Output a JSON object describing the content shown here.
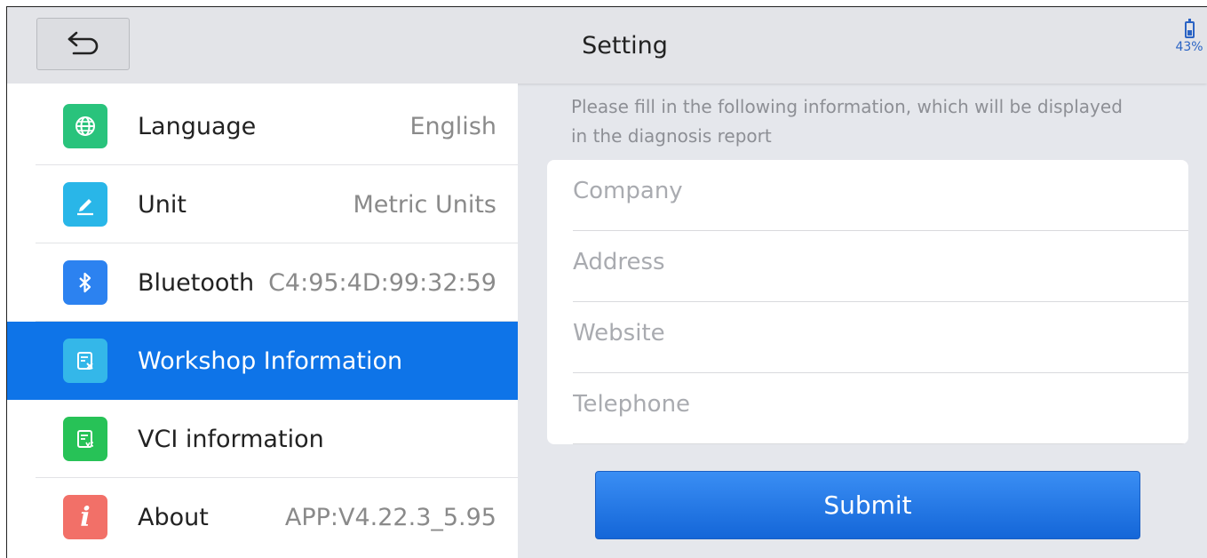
{
  "header": {
    "title": "Setting",
    "battery": "43%"
  },
  "sidebar": {
    "items": [
      {
        "label": "Language",
        "value": "English",
        "icon": "globe-icon",
        "color": "#29c37c"
      },
      {
        "label": "Unit",
        "value": "Metric Units",
        "icon": "ruler-pencil-icon",
        "color": "#29b6e8"
      },
      {
        "label": "Bluetooth",
        "value": "C4:95:4D:99:32:59",
        "icon": "bluetooth-icon",
        "color": "#2c82f0"
      },
      {
        "label": "Workshop Information",
        "value": "",
        "icon": "document-edit-icon",
        "color": "#34b7e9",
        "active": true
      },
      {
        "label": "VCI information",
        "value": "",
        "icon": "vci-document-icon",
        "color": "#27c257"
      },
      {
        "label": "About",
        "value": "APP:V4.22.3_5.95",
        "icon": "info-icon",
        "color": "#f27068"
      }
    ]
  },
  "main": {
    "hint": "Please fill in the following information, which will be displayed in the diagnosis report",
    "fields": {
      "company": {
        "value": "",
        "placeholder": "Company"
      },
      "address": {
        "value": "",
        "placeholder": "Address"
      },
      "website": {
        "value": "",
        "placeholder": "Website"
      },
      "telephone": {
        "value": "",
        "placeholder": "Telephone"
      }
    },
    "submit_label": "Submit"
  },
  "colors": {
    "accent": "#0e74e8",
    "header_bg": "#e3e4e8",
    "panel_bg": "#e5e7ec"
  }
}
